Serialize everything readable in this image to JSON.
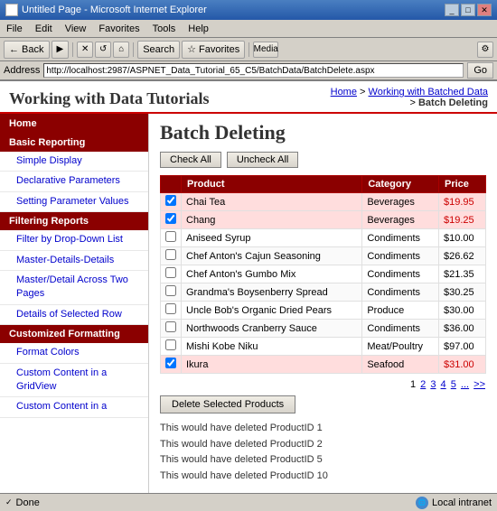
{
  "window": {
    "title": "Untitled Page - Microsoft Internet Explorer",
    "icon": "ie-icon"
  },
  "menubar": {
    "items": [
      "File",
      "Edit",
      "View",
      "Favorites",
      "Tools",
      "Help"
    ]
  },
  "toolbar": {
    "back_label": "← Back",
    "forward_label": "→",
    "stop_label": "✕",
    "refresh_label": "↺",
    "home_label": "⌂",
    "search_label": "Search",
    "favorites_label": "☆ Favorites",
    "media_label": "Media"
  },
  "addressbar": {
    "label": "Address",
    "url": "http://localhost:2987/ASPNET_Data_Tutorial_65_C5/BatchData/BatchDelete.aspx",
    "go_label": "Go"
  },
  "header": {
    "site_title": "Working with Data Tutorials",
    "breadcrumb": {
      "home": "Home",
      "separator1": " > ",
      "section": "Working with Batched Data",
      "separator2": " > ",
      "current": "Batch Deleting"
    }
  },
  "sidebar": {
    "home_label": "Home",
    "sections": [
      {
        "label": "Basic Reporting",
        "links": [
          {
            "label": "Simple Display",
            "active": false
          },
          {
            "label": "Declarative Parameters",
            "active": false
          },
          {
            "label": "Setting Parameter Values",
            "active": false
          }
        ]
      },
      {
        "label": "Filtering Reports",
        "links": [
          {
            "label": "Filter by Drop-Down List",
            "active": false
          },
          {
            "label": "Master-Details-Details",
            "active": false
          },
          {
            "label": "Master/Detail Across Two Pages",
            "active": false
          },
          {
            "label": "Details of Selected Row",
            "active": false
          }
        ]
      },
      {
        "label": "Customized Formatting",
        "links": [
          {
            "label": "Format Colors",
            "active": false
          },
          {
            "label": "Custom Content in a GridView",
            "active": false
          },
          {
            "label": "Custom Content in a",
            "active": false
          }
        ]
      }
    ]
  },
  "main": {
    "page_title": "Batch Deleting",
    "buttons": {
      "check_all": "Check All",
      "uncheck_all": "Uncheck All"
    },
    "table": {
      "columns": [
        "",
        "Product",
        "Category",
        "Price"
      ],
      "rows": [
        {
          "checked": true,
          "product": "Chai Tea",
          "category": "Beverages",
          "price": "$19.95",
          "highlighted": true
        },
        {
          "checked": true,
          "product": "Chang",
          "category": "Beverages",
          "price": "$19.25",
          "highlighted": true
        },
        {
          "checked": false,
          "product": "Aniseed Syrup",
          "category": "Condiments",
          "price": "$10.00",
          "highlighted": false
        },
        {
          "checked": false,
          "product": "Chef Anton's Cajun Seasoning",
          "category": "Condiments",
          "price": "$26.62",
          "highlighted": false
        },
        {
          "checked": false,
          "product": "Chef Anton's Gumbo Mix",
          "category": "Condiments",
          "price": "$21.35",
          "highlighted": false
        },
        {
          "checked": false,
          "product": "Grandma's Boysenberry Spread",
          "category": "Condiments",
          "price": "$30.25",
          "highlighted": false
        },
        {
          "checked": false,
          "product": "Uncle Bob's Organic Dried Pears",
          "category": "Produce",
          "price": "$30.00",
          "highlighted": false
        },
        {
          "checked": false,
          "product": "Northwoods Cranberry Sauce",
          "category": "Condiments",
          "price": "$36.00",
          "highlighted": false
        },
        {
          "checked": false,
          "product": "Mishi Kobe Niku",
          "category": "Meat/Poultry",
          "price": "$97.00",
          "highlighted": false
        },
        {
          "checked": true,
          "product": "Ikura",
          "category": "Seafood",
          "price": "$31.00",
          "highlighted": true
        }
      ]
    },
    "pagination": {
      "current": "1",
      "pages": [
        "2",
        "3",
        "4",
        "5",
        "...",
        ">>"
      ]
    },
    "delete_button": "Delete Selected Products",
    "log_messages": [
      "This would have deleted ProductID 1",
      "This would have deleted ProductID 2",
      "This would have deleted ProductID 5",
      "This would have deleted ProductID 10"
    ]
  },
  "statusbar": {
    "left": "Done",
    "right": "Local intranet"
  },
  "colors": {
    "sidebar_bg": "#8b0000",
    "header_accent": "#cc0000",
    "table_header": "#8b0000",
    "checked_row": "#ffdddd",
    "link_color": "#0000cc"
  }
}
